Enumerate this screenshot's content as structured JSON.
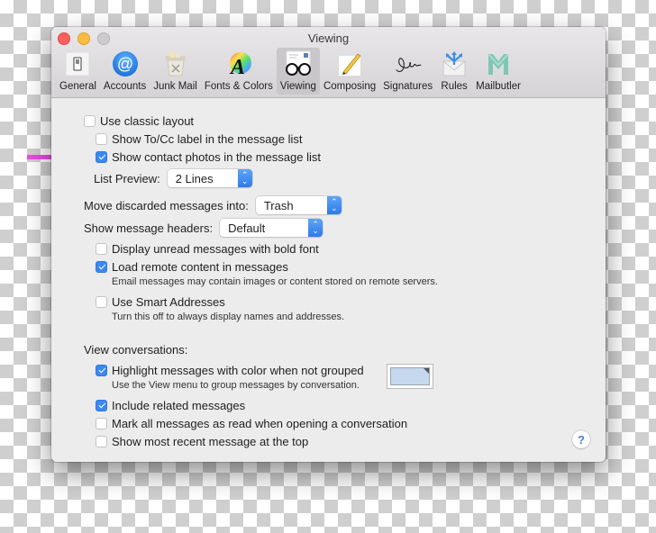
{
  "window": {
    "title": "Viewing",
    "traffic_lights": [
      "close",
      "minimize",
      "zoom"
    ]
  },
  "toolbar": {
    "items": [
      {
        "label": "General",
        "icon": "switch-icon"
      },
      {
        "label": "Accounts",
        "icon": "at-sign-icon"
      },
      {
        "label": "Junk Mail",
        "icon": "trash-bin-icon"
      },
      {
        "label": "Fonts & Colors",
        "icon": "color-wheel-font-icon"
      },
      {
        "label": "Viewing",
        "icon": "glasses-icon",
        "active": true
      },
      {
        "label": "Composing",
        "icon": "pencil-icon"
      },
      {
        "label": "Signatures",
        "icon": "signature-icon"
      },
      {
        "label": "Rules",
        "icon": "rules-envelope-icon"
      },
      {
        "label": "Mailbutler",
        "icon": "mailbutler-logo-icon"
      }
    ]
  },
  "settings": {
    "use_classic_layout": {
      "label": "Use classic layout",
      "checked": false
    },
    "show_tocc_label": {
      "label": "Show To/Cc label in the message list",
      "checked": false
    },
    "show_contact_photos": {
      "label": "Show contact photos in the message list",
      "checked": true
    },
    "list_preview": {
      "label": "List Preview:",
      "value": "2 Lines"
    },
    "move_discarded": {
      "label": "Move discarded messages into:",
      "value": "Trash"
    },
    "show_headers": {
      "label": "Show message headers:",
      "value": "Default"
    },
    "bold_unread": {
      "label": "Display unread messages with bold font",
      "checked": false
    },
    "load_remote": {
      "label": "Load remote content in messages",
      "checked": true,
      "description": "Email messages may contain images or content stored on remote servers."
    },
    "smart_addresses": {
      "label": "Use Smart Addresses",
      "checked": false,
      "description": "Turn this off to always display names and addresses."
    },
    "view_conversations_heading": "View conversations:",
    "highlight_color": {
      "label": "Highlight messages with color when not grouped",
      "checked": true,
      "description": "Use the View menu to group messages by conversation.",
      "color": "#c6d8ee"
    },
    "include_related": {
      "label": "Include related messages",
      "checked": true
    },
    "mark_all_read": {
      "label": "Mark all messages as read when opening a conversation",
      "checked": false
    },
    "most_recent_top": {
      "label": "Show most recent message at the top",
      "checked": false
    }
  },
  "help": {
    "label": "?"
  },
  "annotation": {
    "color": "#e84de0"
  },
  "colors": {
    "accent": "#3b88f3"
  }
}
